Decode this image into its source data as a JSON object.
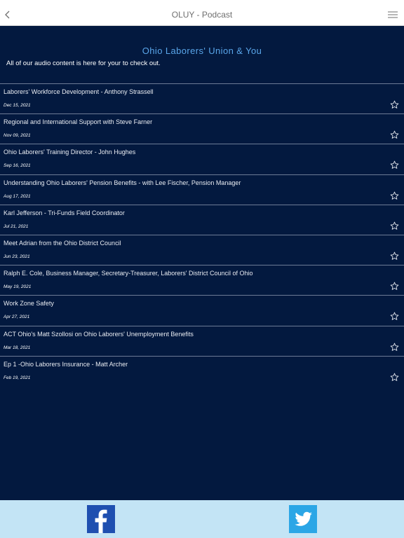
{
  "nav": {
    "title": "OLUY - Podcast",
    "back_icon": "chevron-left-icon",
    "menu_icon": "hamburger-menu-icon"
  },
  "header": {
    "title": "Ohio Laborers' Union & You",
    "subtitle": "All of our audio content is here for your to check out."
  },
  "episodes": [
    {
      "title": "Laborers' Workforce Development - Anthony Strassell",
      "date": "Dec 15, 2021"
    },
    {
      "title": "Regional and International Support with Steve Farner",
      "date": "Nov 09, 2021"
    },
    {
      "title": "Ohio Laborers' Training Director - John Hughes",
      "date": "Sep 16, 2021"
    },
    {
      "title": "Understanding Ohio Laborers' Pension Benefits - with Lee Fischer, Pension Manager",
      "date": "Aug 17, 2021"
    },
    {
      "title": "Karl Jefferson - Tri-Funds Field Coordinator",
      "date": "Jul 21, 2021"
    },
    {
      "title": "Meet Adrian from the Ohio District Council",
      "date": "Jun 23, 2021"
    },
    {
      "title": "Ralph E. Cole, Business Manager, Secretary-Treasurer, Laborers' District Council of Ohio",
      "date": "May 19, 2021"
    },
    {
      "title": "Work Zone Safety",
      "date": "Apr 27, 2021"
    },
    {
      "title": "ACT Ohio's Matt Szollosi on Ohio Laborers' Unemployment Benefits",
      "date": "Mar 18, 2021"
    },
    {
      "title": "Ep 1 -Ohio Laborers Insurance - Matt Archer",
      "date": "Feb 19, 2021"
    }
  ],
  "footer": {
    "facebook_icon": "facebook-icon",
    "twitter_icon": "twitter-icon"
  },
  "colors": {
    "background": "#03193f",
    "accent": "#5aa6ea",
    "footer": "#c3e4f5",
    "facebook": "#1f4fb0",
    "twitter": "#2ba6e6"
  }
}
